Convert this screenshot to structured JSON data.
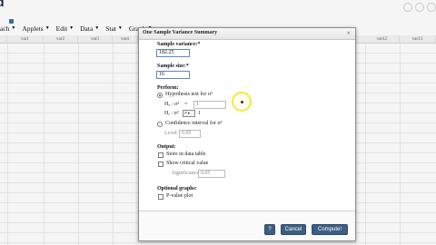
{
  "app": {
    "menus": [
      {
        "label": "ach",
        "has_dropdown": true
      },
      {
        "label": "Applets",
        "has_dropdown": true
      },
      {
        "label": "Edit",
        "has_dropdown": true
      },
      {
        "label": "Data",
        "has_dropdown": true
      },
      {
        "label": "Stat",
        "has_dropdown": true
      },
      {
        "label": "Graph",
        "has_dropdown": true
      }
    ],
    "columns": [
      "var1",
      "var2",
      "var3",
      "var4",
      "var12",
      "var13"
    ]
  },
  "dialog": {
    "title": "One Sample Variance Summary",
    "sample_variance": {
      "label": "Sample variance:*",
      "value": "182.25"
    },
    "sample_size": {
      "label": "Sample size:*",
      "value": "16"
    },
    "perform": {
      "label": "Perform:",
      "hypothesis_test": {
        "label": "Hypothesis test for σ²",
        "checked": true
      },
      "h0": {
        "label": "H₀ : σ²",
        "symbol": "=",
        "value": "1",
        "suffix": ""
      },
      "ha": {
        "label": "Hₐ : σ²",
        "operator": "≠",
        "suffix": "1"
      },
      "confidence_interval": {
        "label": "Confidence interval for σ²",
        "checked": false
      },
      "level": {
        "label": "Level:",
        "value": "0.95"
      }
    },
    "output": {
      "label": "Output:",
      "store_in_table": "Store in data table",
      "show_critical": "Show critical value",
      "significance": {
        "label": "Significance:",
        "value": "0.05"
      }
    },
    "optional_graphs": {
      "label": "Optional graphs:",
      "pvalue_plot": "P-value plot"
    },
    "buttons": {
      "help": "?",
      "cancel": "Cancel",
      "compute": "Compute!"
    }
  },
  "colors": {
    "button": "#3c5e82",
    "highlight": "#f3ea3a",
    "input_border": "#5c87c4"
  }
}
